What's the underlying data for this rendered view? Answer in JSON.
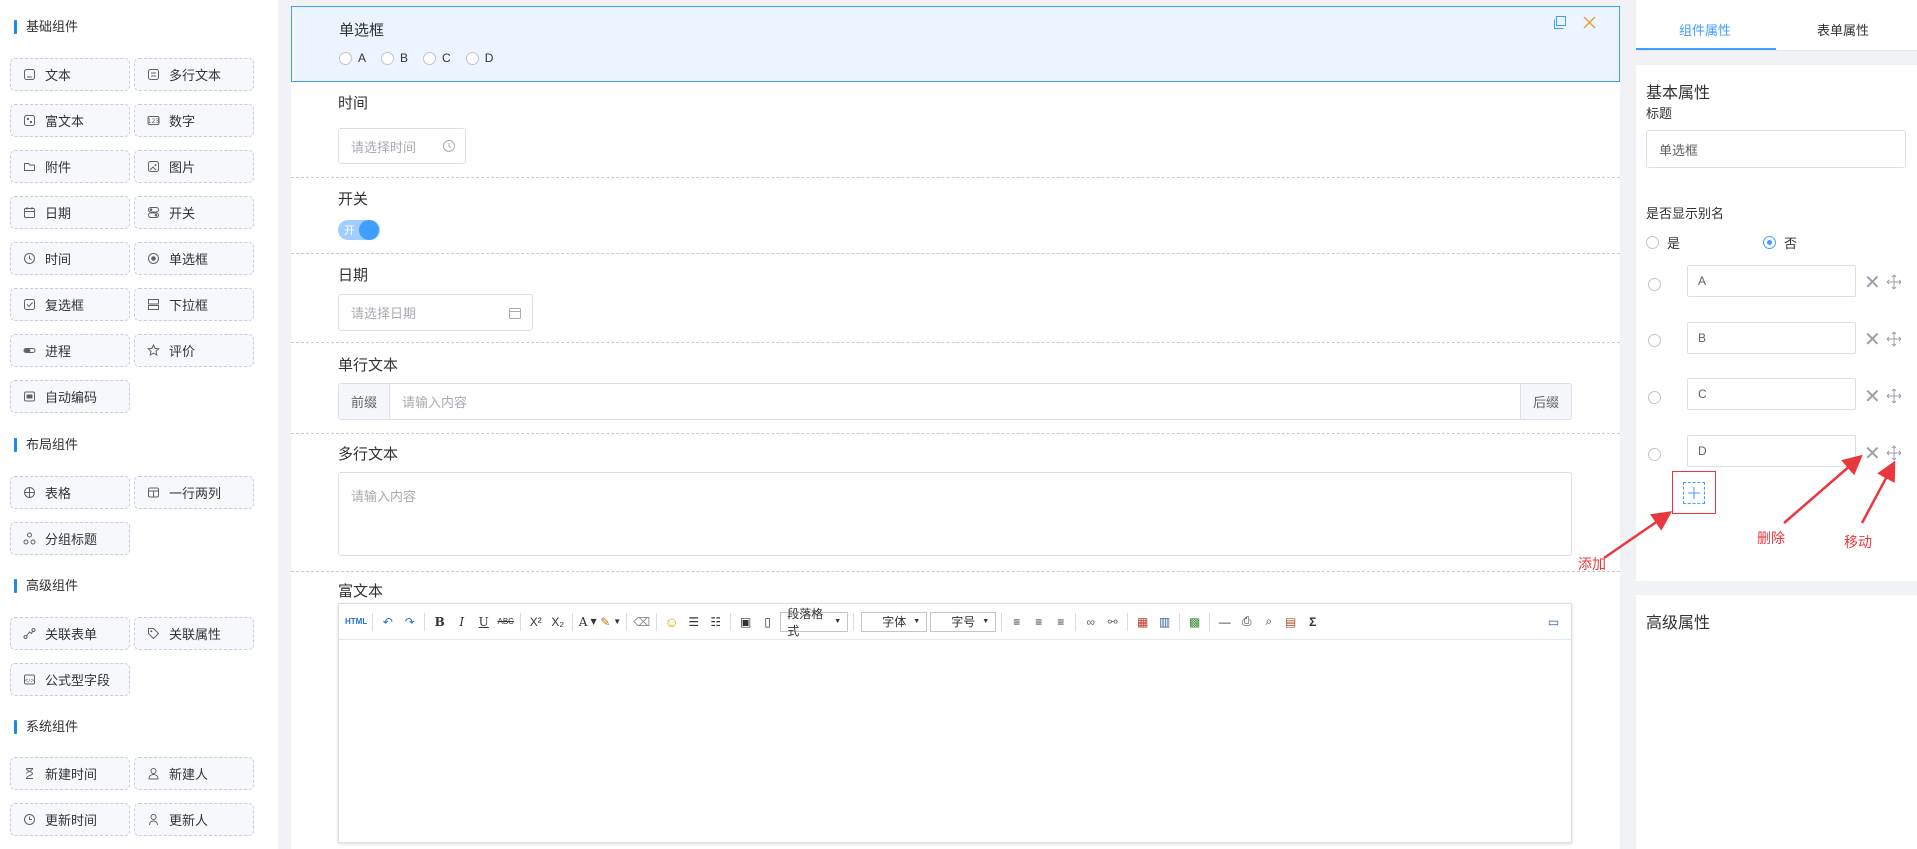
{
  "palette": {
    "groups": [
      {
        "title": "基础组件",
        "items": [
          {
            "label": "文本",
            "icon": "text-field-icon"
          },
          {
            "label": "多行文本",
            "icon": "textarea-icon"
          },
          {
            "label": "富文本",
            "icon": "rich-text-icon"
          },
          {
            "label": "数字",
            "icon": "number-icon"
          },
          {
            "label": "附件",
            "icon": "folder-icon"
          },
          {
            "label": "图片",
            "icon": "image-icon"
          },
          {
            "label": "日期",
            "icon": "calendar-icon"
          },
          {
            "label": "开关",
            "icon": "switch-icon"
          },
          {
            "label": "时间",
            "icon": "clock-icon"
          },
          {
            "label": "单选框",
            "icon": "radio-icon"
          },
          {
            "label": "复选框",
            "icon": "checkbox-icon"
          },
          {
            "label": "下拉框",
            "icon": "select-icon"
          },
          {
            "label": "进程",
            "icon": "progress-icon"
          },
          {
            "label": "评价",
            "icon": "star-icon"
          },
          {
            "label": "自动编码",
            "icon": "auto-code-icon"
          }
        ]
      },
      {
        "title": "布局组件",
        "items": [
          {
            "label": "表格",
            "icon": "table-icon"
          },
          {
            "label": "一行两列",
            "icon": "two-column-icon"
          },
          {
            "label": "分组标题",
            "icon": "group-title-icon"
          }
        ]
      },
      {
        "title": "高级组件",
        "items": [
          {
            "label": "关联表单",
            "icon": "link-form-icon"
          },
          {
            "label": "关联属性",
            "icon": "tag-icon"
          },
          {
            "label": "公式型字段",
            "icon": "formula-icon"
          }
        ]
      },
      {
        "title": "系统组件",
        "items": [
          {
            "label": "新建时间",
            "icon": "hourglass-icon"
          },
          {
            "label": "新建人",
            "icon": "user-icon"
          },
          {
            "label": "更新时间",
            "icon": "clock-refresh-icon"
          },
          {
            "label": "更新人",
            "icon": "user-edit-icon"
          }
        ]
      }
    ]
  },
  "canvas": {
    "radio_field": {
      "label": "单选框",
      "options": [
        "A",
        "B",
        "C",
        "D"
      ]
    },
    "time_field": {
      "label": "时间",
      "placeholder": "请选择时间"
    },
    "switch_field": {
      "label": "开关",
      "switch_text": "开"
    },
    "date_field": {
      "label": "日期",
      "placeholder": "请选择日期"
    },
    "text_field": {
      "label": "单行文本",
      "prefix": "前缀",
      "placeholder": "请输入内容",
      "suffix": "后缀"
    },
    "textarea_field": {
      "label": "多行文本",
      "placeholder": "请输入内容"
    },
    "rich_field": {
      "label": "富文本",
      "toolbar": {
        "html": "HTML",
        "paragraph": "段落格式",
        "font": "字体",
        "size": "字号",
        "bold": "B",
        "italic": "I",
        "underline": "U",
        "strike": "ABC",
        "font_color": "A",
        "sigma": "Σ"
      }
    }
  },
  "panel": {
    "tabs": [
      "组件属性",
      "表单属性"
    ],
    "basic_title": "基本属性",
    "title_label": "标题",
    "title_value": "单选框",
    "alias_label": "是否显示别名",
    "alias_yes": "是",
    "alias_no": "否",
    "alias_selected": "否",
    "options": [
      "A",
      "B",
      "C",
      "D"
    ],
    "advanced_title": "高级属性"
  },
  "annotations": {
    "add": "添加",
    "delete": "删除",
    "move": "移动"
  },
  "colors": {
    "accent": "#409eff",
    "annotation": "#e8383d",
    "active_bg": "#ecf5ff"
  }
}
